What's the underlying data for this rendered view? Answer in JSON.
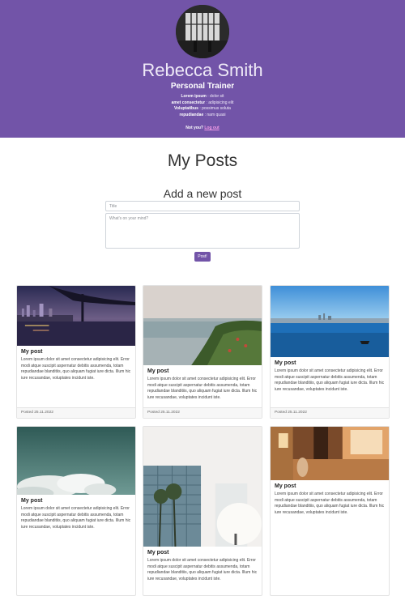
{
  "profile": {
    "name": "Rebecca Smith",
    "role": "Personal Trainer",
    "details": [
      {
        "key": "Lorem ipsum",
        "value": ": dolor sit"
      },
      {
        "key": "amet consectetur",
        "value": ": adipisicing elit"
      },
      {
        "key": "Voluptatibus",
        "value": ": possimus soluta"
      },
      {
        "key": "repudiandae",
        "value": ": nam quasi"
      }
    ],
    "not_you": "Not you?",
    "logout": "Log out"
  },
  "page": {
    "title": "My Posts",
    "add_title": "Add a new post"
  },
  "form": {
    "title_placeholder": "Title",
    "body_placeholder": "What's on your mind?",
    "submit_label": "Post!"
  },
  "posts": [
    {
      "title": "My post",
      "text": "Lorem ipsum dolor sit amet consectetur adipisicing elit. Error modi atque suscipit aspernatur debitis assumenda, totam repudiandae blanditiis, quo aliquam fugiat iure dicta. Illum hic iure recusandae, voluptates incidunt iste.",
      "date": "Posted 25.11.2022"
    },
    {
      "title": "My post",
      "text": "Lorem ipsum dolor sit amet consectetur adipisicing elit. Error modi atque suscipit aspernatur debitis assumenda, totam repudiandae blanditiis, quo aliquam fugiat iure dicta. Illum hic iure recusandae, voluptates incidunt iste.",
      "date": "Posted 25.11.2022"
    },
    {
      "title": "My post",
      "text": "Lorem ipsum dolor sit amet consectetur adipisicing elit. Error modi atque suscipit aspernatur debitis assumenda, totam repudiandae blanditiis, quo aliquam fugiat iure dicta. Illum hic iure recusandae, voluptates incidunt iste.",
      "date": "Posted 25.11.2022"
    },
    {
      "title": "My post",
      "text": "Lorem ipsum dolor sit amet consectetur adipisicing elit. Error modi atque suscipit aspernatur debitis assumenda, totam repudiandae blanditiis, quo aliquam fugiat iure dicta. Illum hic iure recusandae, voluptates incidunt iste."
    },
    {
      "title": "My post",
      "text": "Lorem ipsum dolor sit amet consectetur adipisicing elit. Error modi atque suscipit aspernatur debitis assumenda, totam repudiandae blanditiis, quo aliquam fugiat iure dicta. Illum hic iure recusandae, voluptates incidunt iste."
    },
    {
      "title": "My post",
      "text": "Lorem ipsum dolor sit amet consectetur adipisicing elit. Error modi atque suscipit aspernatur debitis assumenda, totam repudiandae blanditiis, quo aliquam fugiat iure dicta. Illum hic iure recusandae, voluptates incidunt iste."
    }
  ],
  "colors": {
    "header_bg": "#7254a8",
    "button_bg": "#7254a8",
    "logout_link": "#f29be6"
  }
}
